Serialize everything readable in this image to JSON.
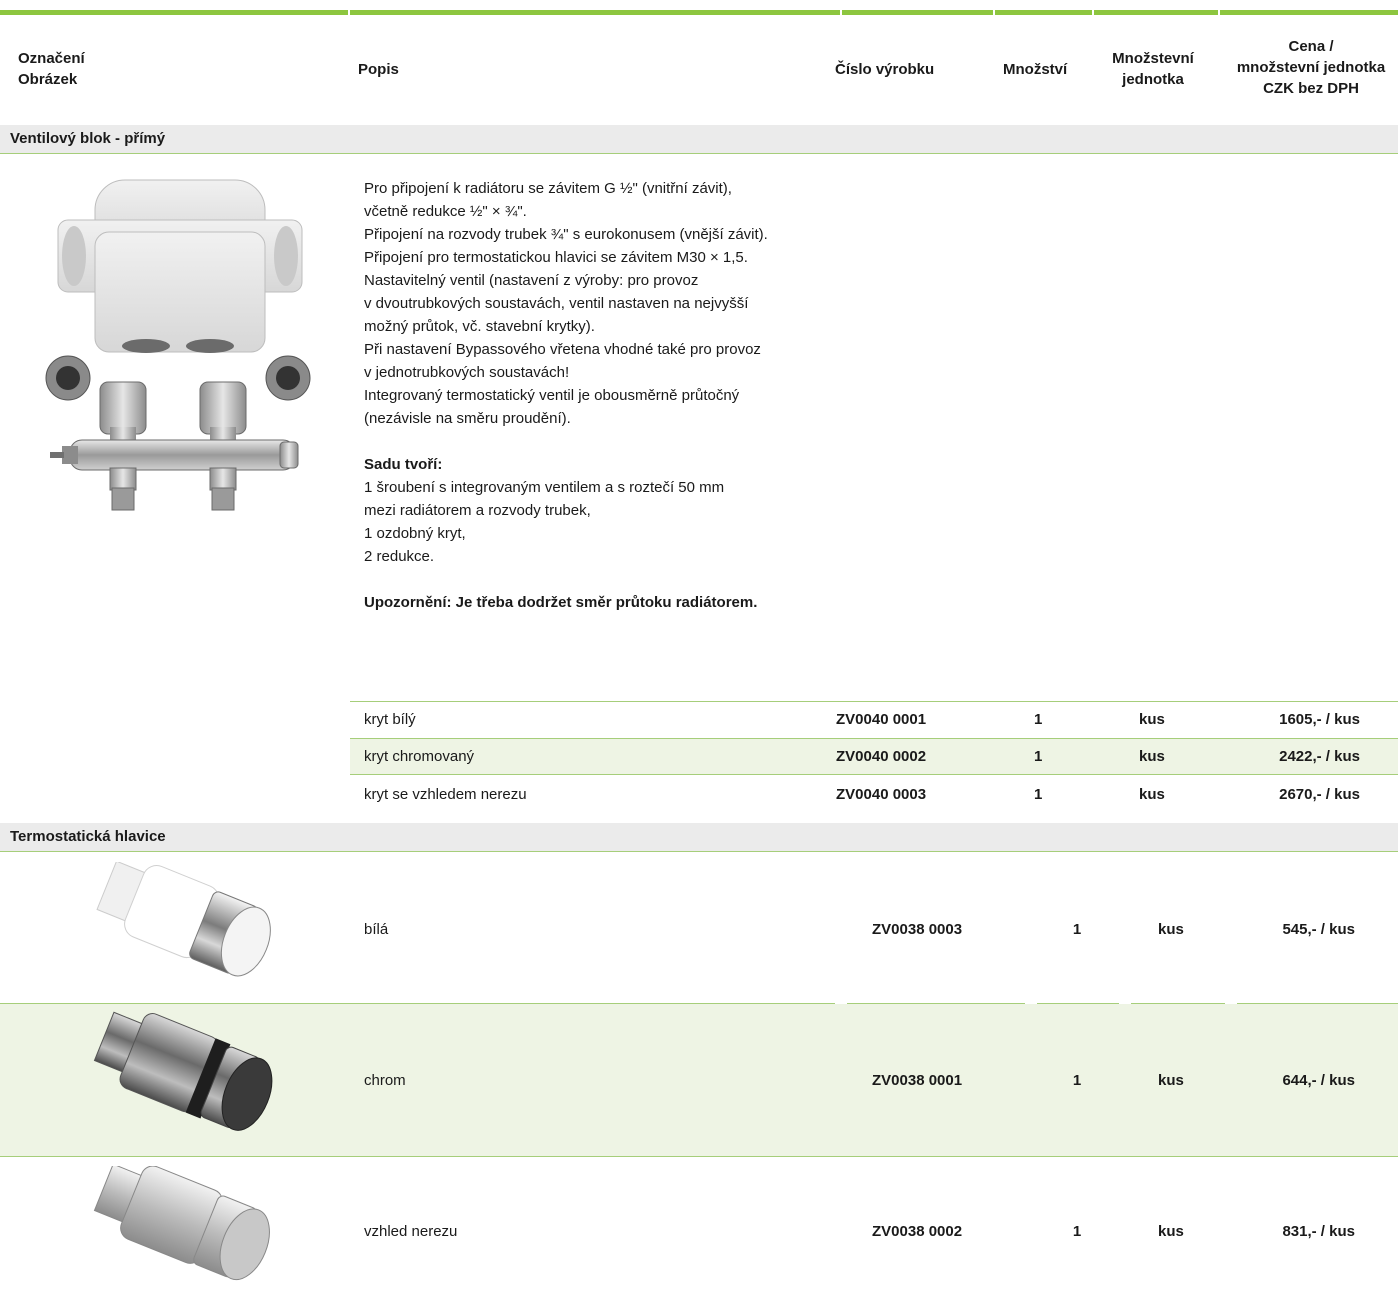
{
  "header": {
    "col1_line1": "Označení",
    "col1_line2": "Obrázek",
    "col2": "Popis",
    "col3": "Číslo výrobku",
    "col4": "Množství",
    "col5_line1": "Množstevní",
    "col5_line2": "jednotka",
    "col6_line1": "Cena /",
    "col6_line2": "množstevní jednotka",
    "col6_line3": "CZK bez DPH"
  },
  "section1": {
    "title": "Ventilový blok - přímý",
    "description": "Pro připojení k radiátoru se závitem G ½\" (vnitřní závit),\nvčetně redukce ½\" × ¾\".\nPřipojení na rozvody trubek ¾\" s eurokonusem (vnější závit).\nPřipojení pro termostatickou hlavici se závitem M30 × 1,5.\nNastavitelný ventil (nastavení z výroby: pro provoz\nv dvoutrubkových soustavách, ventil nastaven na nejvyšší\nmožný průtok, vč. stavební krytky).\nPři nastavení Bypassového vřetena vhodné také pro provoz\nv jednotrubkových soustavách!\nIntegrovaný termostatický ventil je obousměrně průtočný\n(nezávisle na směru proudění).",
    "set_heading": "Sadu tvoří:",
    "set_items": "1 šroubení s integrovaným ventilem a s roztečí 50 mm\nmezi radiátorem a rozvody trubek,\n1 ozdobný kryt,\n2 redukce.",
    "warning": "Upozornění: Je třeba dodržet směr průtoku radiátorem.",
    "rows": [
      {
        "desc": "kryt bílý",
        "code": "ZV0040 0001",
        "qty": "1",
        "unit": "kus",
        "price": "1605,- / kus"
      },
      {
        "desc": "kryt chromovaný",
        "code": "ZV0040 0002",
        "qty": "1",
        "unit": "kus",
        "price": "2422,- / kus"
      },
      {
        "desc": "kryt se vzhledem nerezu",
        "code": "ZV0040 0003",
        "qty": "1",
        "unit": "kus",
        "price": "2670,- / kus"
      }
    ]
  },
  "section2": {
    "title": "Termostatická hlavice",
    "rows": [
      {
        "desc": "bílá",
        "code": "ZV0038 0003",
        "qty": "1",
        "unit": "kus",
        "price": "545,- / kus"
      },
      {
        "desc": "chrom",
        "code": "ZV0038 0001",
        "qty": "1",
        "unit": "kus",
        "price": "644,- / kus"
      },
      {
        "desc": "vzhled nerezu",
        "code": "ZV0038 0002",
        "qty": "1",
        "unit": "kus",
        "price": "831,- / kus"
      }
    ]
  },
  "colors": {
    "accent_green": "#8dc63f",
    "rule_green": "#a6ce7a",
    "band_gray": "#ebebeb",
    "row_shade": "#eef4e4"
  }
}
